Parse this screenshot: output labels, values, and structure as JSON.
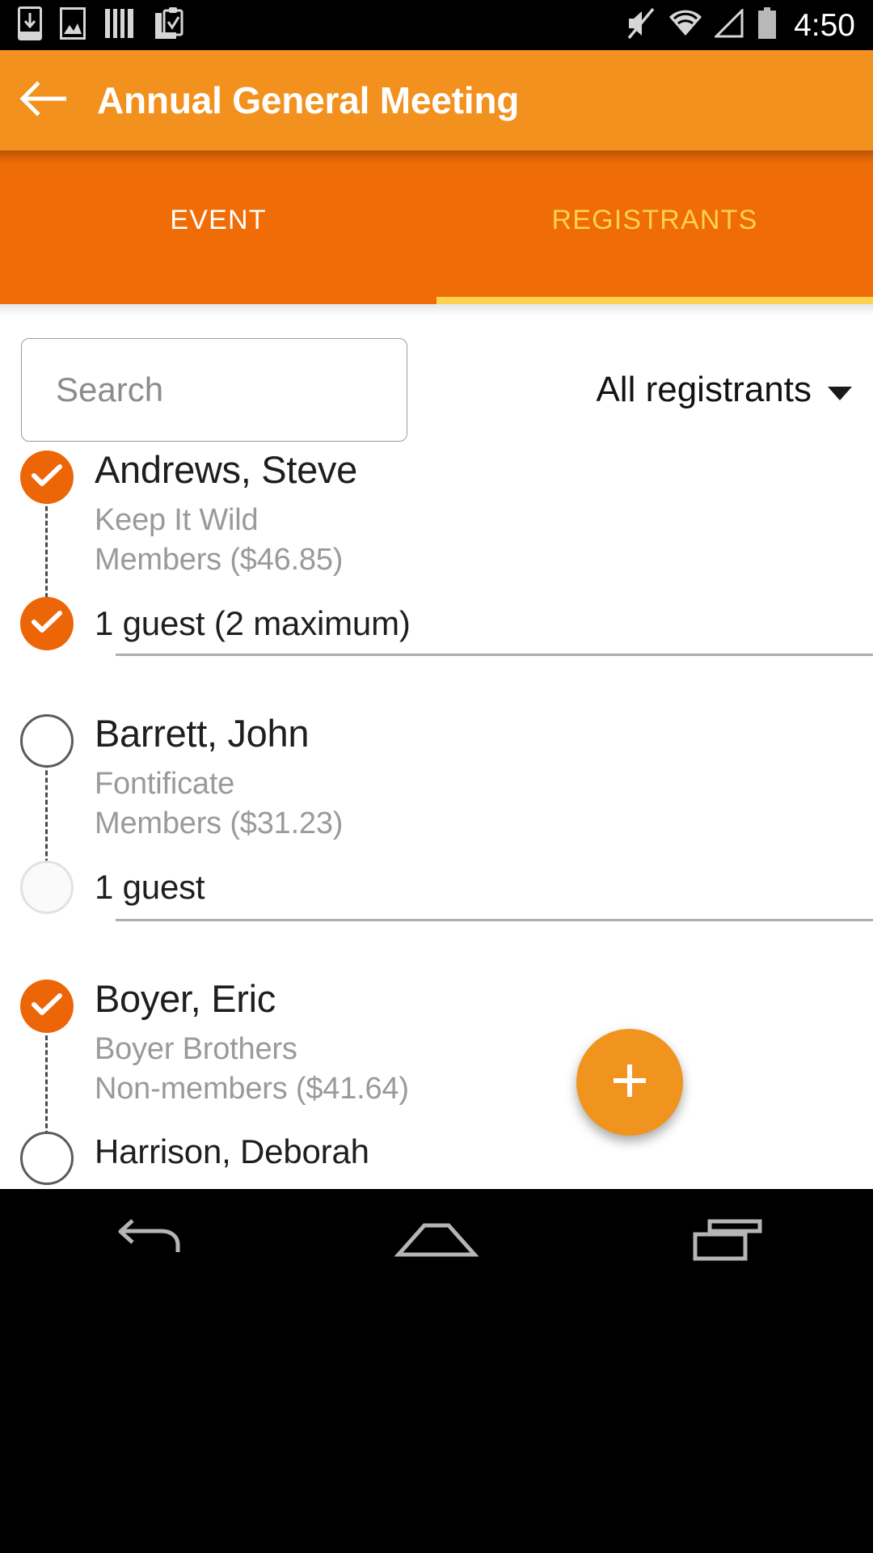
{
  "statusbar": {
    "time": "4:50",
    "left_icons": [
      "download-icon",
      "gallery-icon",
      "barcode-icon",
      "clipboard-check-icon"
    ],
    "right_icons": [
      "volume-mute-icon",
      "wifi-icon",
      "cellular-signal-icon",
      "battery-icon"
    ]
  },
  "appbar": {
    "title": "Annual General Meeting",
    "back_icon": "back-arrow-icon",
    "background_color": "#f3911e"
  },
  "tabs": {
    "items": [
      {
        "label": "EVENT",
        "active": false
      },
      {
        "label": "REGISTRANTS",
        "active": true
      }
    ],
    "background_color": "#ef6c06",
    "active_color": "#ffd24d",
    "inactive_color": "#ffffff"
  },
  "filter": {
    "search_placeholder": "Search",
    "search_value": "",
    "dropdown_label": "All registrants",
    "dropdown_icon": "chevron-down-icon"
  },
  "registrants": [
    {
      "name": "Andrews, Steve",
      "organization": "Keep It Wild",
      "category": "Members ($46.85)",
      "checked": true,
      "guest": {
        "label": "1 guest (2 maximum)",
        "checked": true,
        "disabled": false
      }
    },
    {
      "name": "Barrett, John",
      "organization": "Fontificate",
      "category": "Members ($31.23)",
      "checked": false,
      "guest": {
        "label": "1 guest",
        "checked": false,
        "disabled": true
      }
    },
    {
      "name": "Boyer, Eric",
      "organization": "Boyer Brothers",
      "category": "Non-members ($41.64)",
      "checked": true,
      "guest": null
    },
    {
      "name": "Harrison, Deborah",
      "organization": "",
      "category": "",
      "checked": false,
      "guest": null
    }
  ],
  "fab": {
    "icon": "plus-icon",
    "label": "+",
    "color": "#f1931f"
  },
  "navbar": {
    "buttons": [
      "back-nav-icon",
      "home-nav-icon",
      "recents-nav-icon"
    ],
    "background_color": "#000000"
  },
  "theme": {
    "accent": "#ec6608",
    "appbar": "#f3911e",
    "tabbar": "#ef6c06",
    "tab_active": "#ffd24d",
    "secondary_text": "#9a9a9a",
    "primary_text": "#1e1e1e"
  }
}
